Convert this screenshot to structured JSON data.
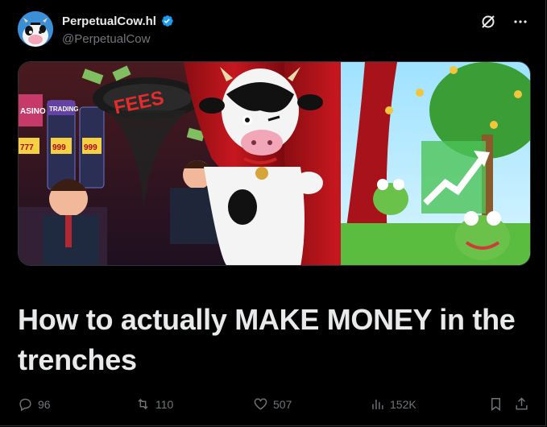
{
  "author": {
    "display_name": "PerpetualCow.hl",
    "handle": "@PerpetualCow",
    "verified": true,
    "verified_color": "#1d9bf0"
  },
  "top_actions": {
    "icons": [
      "grok-icon",
      "more-icon"
    ]
  },
  "media": {
    "sign_text": "FEES",
    "slot_signs": [
      "ASINO",
      "TRADING"
    ],
    "slot_reels": [
      "777",
      "999",
      "999"
    ]
  },
  "headline": "How to actually MAKE MONEY in the trenches",
  "stats": {
    "replies": "96",
    "reposts": "110",
    "likes": "507",
    "views": "152K"
  },
  "colors": {
    "background": "#000000",
    "text_primary": "#e7e9ea",
    "text_secondary": "#71767b",
    "border": "#2f3336"
  }
}
